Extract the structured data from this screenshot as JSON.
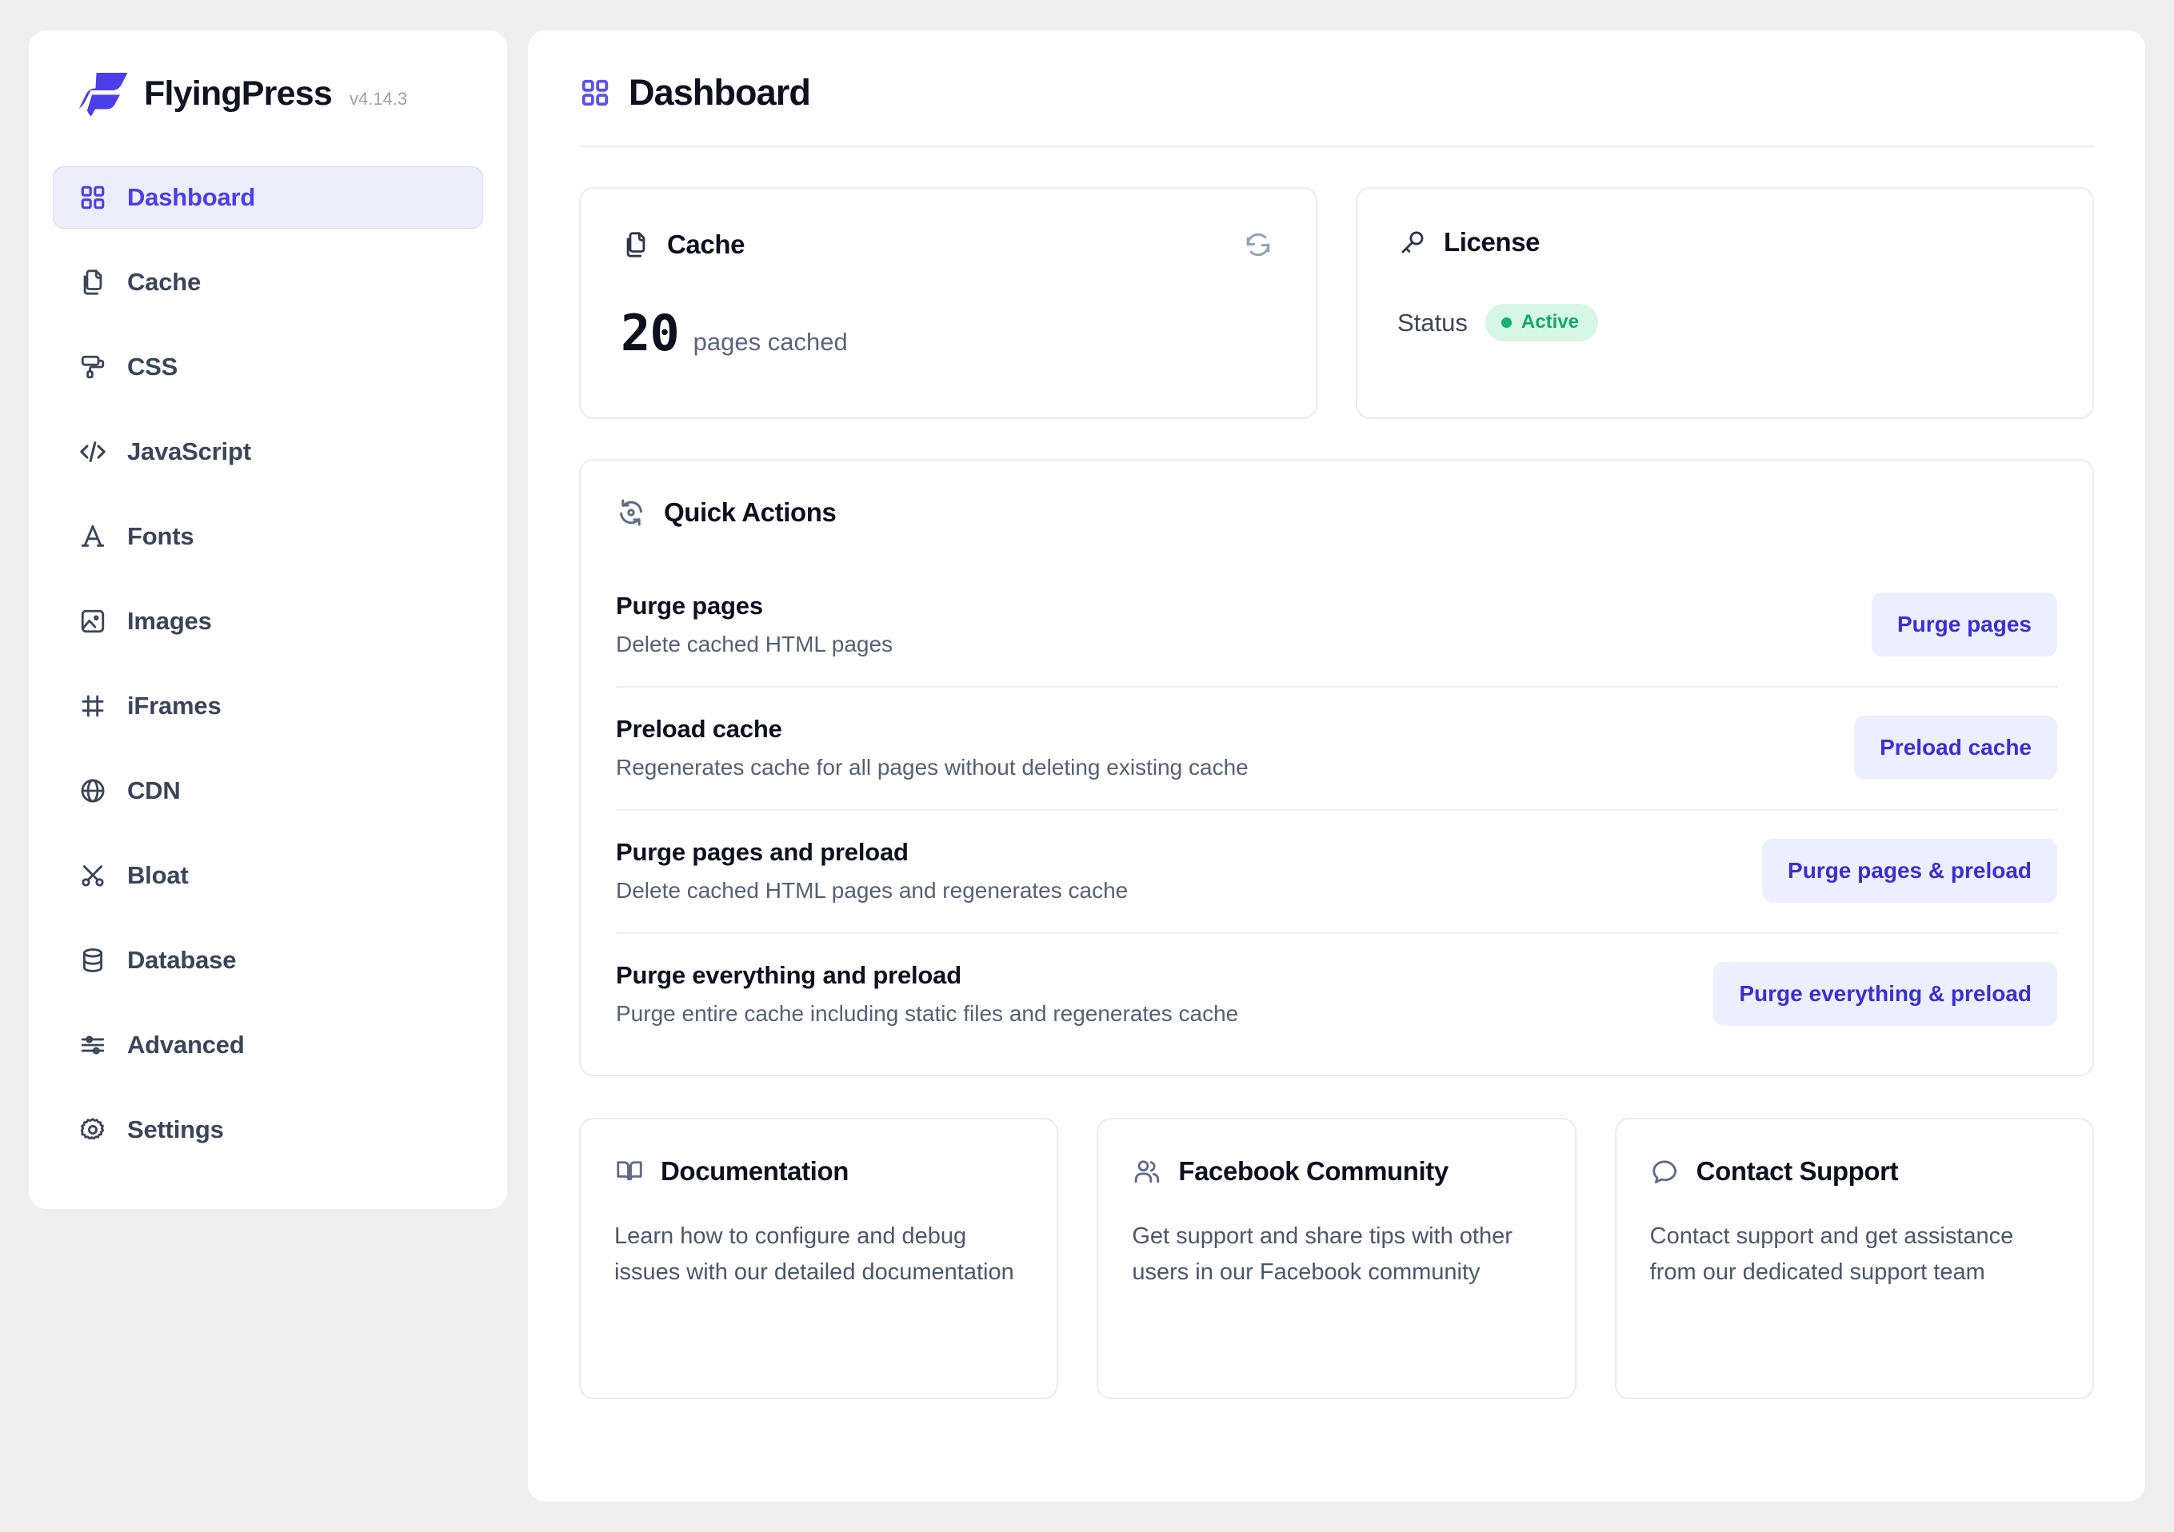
{
  "brand": {
    "name": "FlyingPress",
    "version": "v4.14.3",
    "logo_icon": "flyingpress-logo",
    "logo_color": "#4b3ee8"
  },
  "colors": {
    "accent": "#4b3ee8",
    "accent_soft_bg": "#eceefc",
    "button_bg": "#ecefff",
    "button_text": "#3b2fd1",
    "status_green_text": "#11a86a",
    "status_green_bg": "#d6f7e4",
    "page_bg": "#efeff0",
    "panel_bg": "#ffffff",
    "border": "#e8ebf2",
    "heading": "#0e1020",
    "body_text": "#4c566b"
  },
  "sidebar": {
    "items": [
      {
        "label": "Dashboard",
        "icon": "grid-icon",
        "active": true
      },
      {
        "label": "Cache",
        "icon": "copy-icon",
        "active": false
      },
      {
        "label": "CSS",
        "icon": "paint-roller-icon",
        "active": false
      },
      {
        "label": "JavaScript",
        "icon": "code-icon",
        "active": false
      },
      {
        "label": "Fonts",
        "icon": "letter-a-icon",
        "active": false
      },
      {
        "label": "Images",
        "icon": "image-icon",
        "active": false
      },
      {
        "label": "iFrames",
        "icon": "frame-icon",
        "active": false
      },
      {
        "label": "CDN",
        "icon": "globe-icon",
        "active": false
      },
      {
        "label": "Bloat",
        "icon": "scissors-icon",
        "active": false
      },
      {
        "label": "Database",
        "icon": "database-icon",
        "active": false
      },
      {
        "label": "Advanced",
        "icon": "sliders-icon",
        "active": false
      },
      {
        "label": "Settings",
        "icon": "gear-icon",
        "active": false
      }
    ]
  },
  "page": {
    "title": "Dashboard",
    "title_icon": "grid-icon"
  },
  "cache_card": {
    "title": "Cache",
    "icon": "copy-icon",
    "refresh_icon": "refresh-icon",
    "value": "20",
    "unit": "pages cached"
  },
  "license_card": {
    "title": "License",
    "icon": "key-icon",
    "status_label": "Status",
    "status_value": "Active",
    "status_dot_icon": "status-dot-icon"
  },
  "quick_actions": {
    "title": "Quick Actions",
    "icon": "refresh-cycle-icon",
    "rows": [
      {
        "name": "Purge pages",
        "description": "Delete cached HTML pages",
        "button": "Purge pages"
      },
      {
        "name": "Preload cache",
        "description": "Regenerates cache for all pages without deleting existing cache",
        "button": "Preload cache"
      },
      {
        "name": "Purge pages and preload",
        "description": "Delete cached HTML pages and regenerates cache",
        "button": "Purge pages & preload"
      },
      {
        "name": "Purge everything and preload",
        "description": "Purge entire cache including static files and regenerates cache",
        "button": "Purge everything & preload"
      }
    ]
  },
  "link_cards": [
    {
      "title": "Documentation",
      "icon": "book-icon",
      "description": "Learn how to configure and debug issues with our detailed documentation"
    },
    {
      "title": "Facebook Community",
      "icon": "users-icon",
      "description": "Get support and share tips with other users in our Facebook community"
    },
    {
      "title": "Contact Support",
      "icon": "chat-bubble-icon",
      "description": "Contact support and get assistance from our dedicated support team"
    }
  ]
}
